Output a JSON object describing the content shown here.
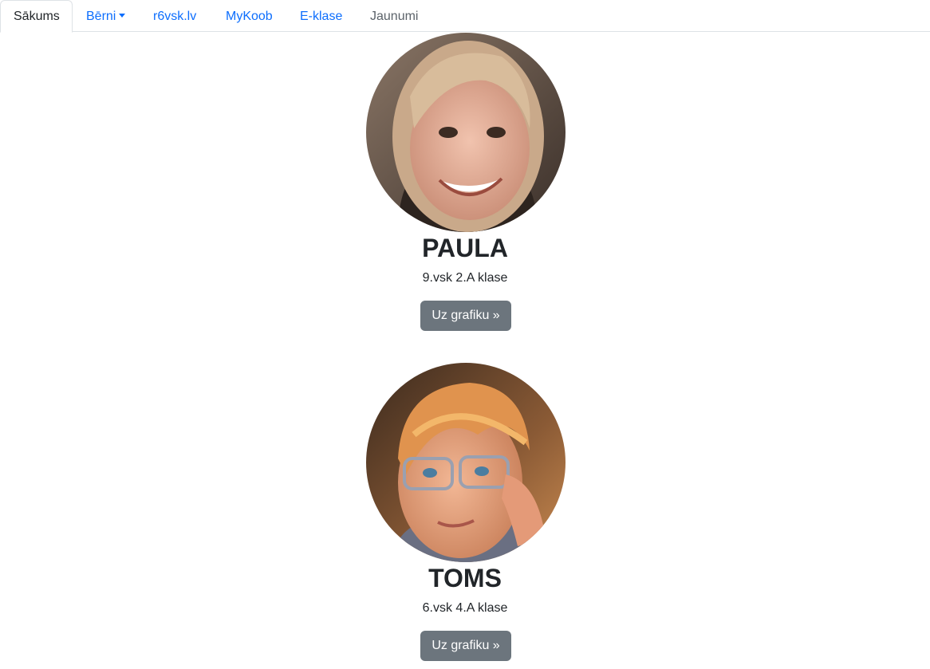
{
  "nav": {
    "tabs": [
      {
        "label": "Sākums"
      },
      {
        "label": "Bērni"
      },
      {
        "label": "r6vsk.lv"
      },
      {
        "label": "MyKoob"
      },
      {
        "label": "E-klase"
      },
      {
        "label": "Jaunumi"
      }
    ],
    "active_tab": "Sākums"
  },
  "children": [
    {
      "name": "PAULA",
      "klase": "9.vsk 2.A klase",
      "button_label": "Uz grafiku »",
      "photo": "girl-portrait"
    },
    {
      "name": "TOMS",
      "klase": "6.vsk 4.A klase",
      "button_label": "Uz grafiku »",
      "photo": "boy-with-glasses-portrait"
    }
  ],
  "colors": {
    "link": "#0d6efd",
    "button": "#6c757d",
    "border": "#dee2e6"
  }
}
